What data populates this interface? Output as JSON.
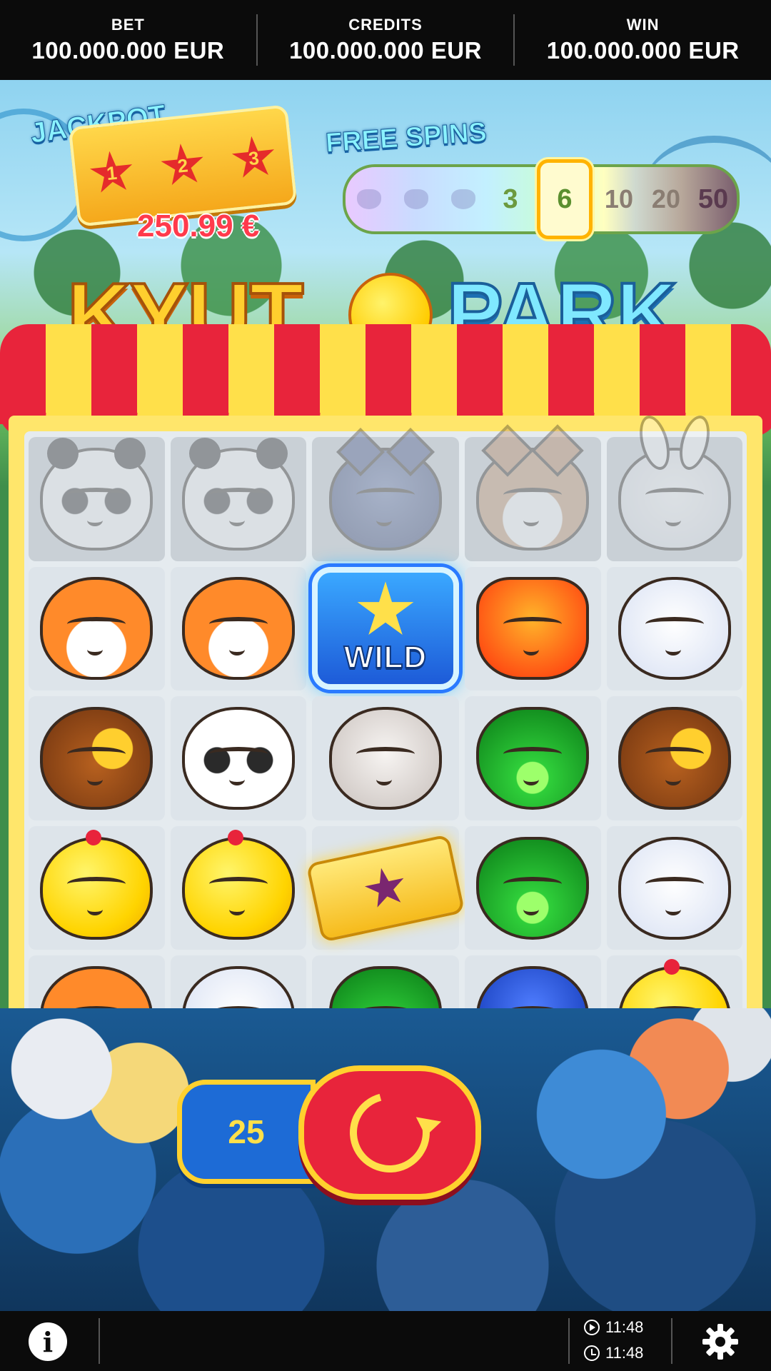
{
  "header": {
    "bet_label": "BET",
    "bet_value": "100.000.000 EUR",
    "credits_label": "CREDITS",
    "credits_value": "100.000.000 EUR",
    "win_label": "WIN",
    "win_value": "100.000.000 EUR"
  },
  "jackpot": {
    "title": "JACKPOT",
    "stars": [
      "1",
      "2",
      "3"
    ],
    "amount": "250.99 €"
  },
  "free_spins": {
    "title": "FREE SPINS",
    "steps": [
      "3",
      "6",
      "10",
      "20",
      "50"
    ],
    "active_step": "6"
  },
  "logo": {
    "word1": "KYUT",
    "word2": "PARK"
  },
  "reels": {
    "rows": [
      [
        "panda",
        "panda",
        "blue-cat",
        "fox",
        "bunny"
      ],
      [
        "fox",
        "fox",
        "wild",
        "dragon",
        "bunny"
      ],
      [
        "wolf",
        "panda",
        "mouse",
        "frog",
        "wolf"
      ],
      [
        "chick",
        "chick",
        "ticket",
        "frog",
        "bunny"
      ],
      [
        "fox",
        "bunny",
        "frog",
        "blue-cat",
        "chick"
      ]
    ],
    "ghost_row": 0,
    "wild_label": "WILD"
  },
  "controls": {
    "bet_lines": "25"
  },
  "footer": {
    "time_played": "11:48",
    "clock": "11:48"
  },
  "colors": {
    "accent_red": "#e8243b",
    "accent_yellow": "#ffd12e",
    "bar_bg": "#0b0b0b"
  }
}
